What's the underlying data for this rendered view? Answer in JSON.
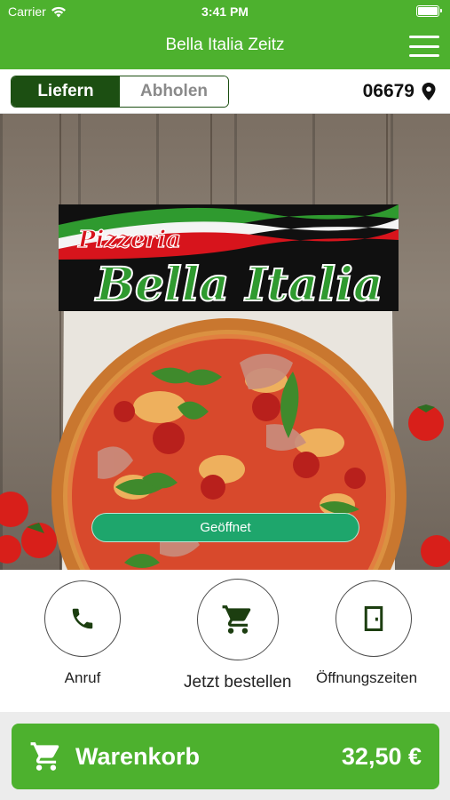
{
  "status_bar": {
    "carrier": "Carrier",
    "time": "3:41 PM"
  },
  "header": {
    "title": "Bella Italia Zeitz"
  },
  "delivery_mode": {
    "options": [
      "Liefern",
      "Abholen"
    ],
    "selected": "Liefern"
  },
  "location": {
    "zip": "06679"
  },
  "hero": {
    "logo_line1": "Pizzeria",
    "logo_line2": "Bella Italia",
    "status": "Geöffnet"
  },
  "actions": [
    {
      "label": "Anruf",
      "icon": "phone-icon"
    },
    {
      "label": "Jetzt bestellen",
      "icon": "cart-icon"
    },
    {
      "label": "Öffnungszeiten",
      "icon": "door-icon"
    }
  ],
  "cart": {
    "label": "Warenkorb",
    "total": "32,50 €",
    "icon": "cart-icon"
  },
  "colors": {
    "primary_green": "#4db12e",
    "dark_green": "#1c4f12",
    "status_green": "#1ea66c"
  }
}
